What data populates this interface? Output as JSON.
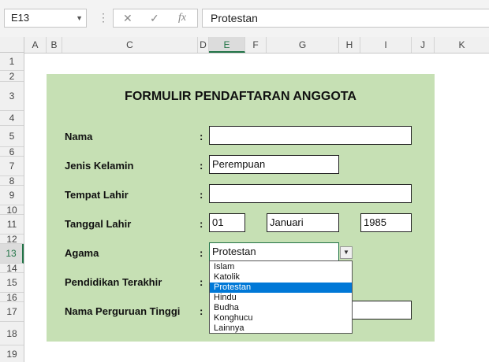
{
  "formula_bar": {
    "name_box": "E13",
    "cancel_icon": "✕",
    "enter_icon": "✓",
    "fx_label": "fx",
    "content": "Protestan"
  },
  "columns": [
    "A",
    "B",
    "C",
    "D",
    "E",
    "F",
    "G",
    "H",
    "I",
    "J",
    "K"
  ],
  "selected_column": "E",
  "rows": [
    "1",
    "2",
    "3",
    "4",
    "5",
    "6",
    "7",
    "8",
    "9",
    "10",
    "11",
    "12",
    "13",
    "14",
    "15",
    "16",
    "17",
    "18",
    "19"
  ],
  "selected_row": "13",
  "form": {
    "title": "FORMULIR PENDAFTARAN ANGGOTA",
    "colon": ":",
    "labels": {
      "nama": "Nama",
      "jenis_kelamin": "Jenis Kelamin",
      "tempat_lahir": "Tempat Lahir",
      "tanggal_lahir": "Tanggal Lahir",
      "agama": "Agama",
      "pendidikan": "Pendidikan Terakhir",
      "perguruan": "Nama Perguruan Tinggi"
    },
    "values": {
      "nama": "",
      "jenis_kelamin": "Perempuan",
      "tempat_lahir": "",
      "tanggal_hari": "01",
      "tanggal_bulan": "Januari",
      "tanggal_tahun": "1985",
      "agama": "Protestan",
      "pendidikan": "",
      "perguruan": ""
    }
  },
  "dropdown": {
    "options": [
      "Islam",
      "Katolik",
      "Protestan",
      "Hindu",
      "Budha",
      "Konghucu",
      "Lainnya"
    ],
    "selected": "Protestan"
  },
  "colors": {
    "form_bg": "#c6e0b4",
    "selection_accent": "#217346",
    "highlight": "#0078d7"
  }
}
